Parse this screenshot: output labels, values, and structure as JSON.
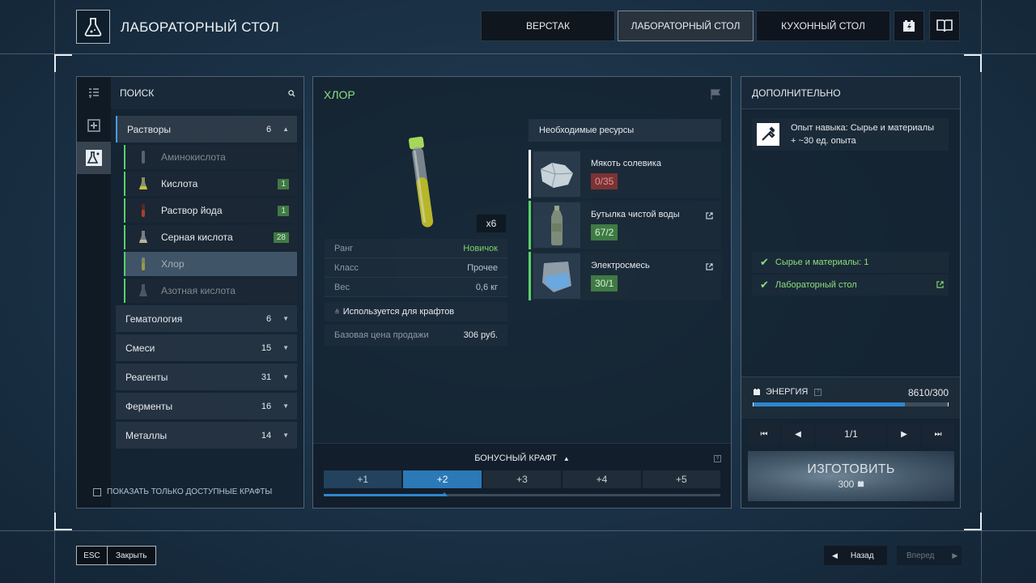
{
  "header": {
    "title": "ЛАБОРАТОРНЫЙ СТОЛ",
    "icon": "flask-icon",
    "tabs": [
      {
        "label": "ВЕРСТАК",
        "active": false
      },
      {
        "label": "ЛАБОРАТОРНЫЙ СТОЛ",
        "active": true
      },
      {
        "label": "КУХОННЫЙ СТОЛ",
        "active": false
      }
    ]
  },
  "sidebar": {
    "search_placeholder": "ПОИСК",
    "categories": [
      {
        "name": "Растворы",
        "count": "6",
        "open": true,
        "items": [
          {
            "name": "Аминокислота",
            "badge": "",
            "state": "disabled"
          },
          {
            "name": "Кислота",
            "badge": "1",
            "state": "normal"
          },
          {
            "name": "Раствор йода",
            "badge": "1",
            "state": "normal"
          },
          {
            "name": "Серная кислота",
            "badge": "28",
            "state": "normal"
          },
          {
            "name": "Хлор",
            "badge": "",
            "state": "selected"
          },
          {
            "name": "Азотная кислота",
            "badge": "",
            "state": "disabled"
          }
        ]
      },
      {
        "name": "Гематология",
        "count": "6",
        "open": false
      },
      {
        "name": "Смеси",
        "count": "15",
        "open": false
      },
      {
        "name": "Реагенты",
        "count": "31",
        "open": false
      },
      {
        "name": "Ферменты",
        "count": "16",
        "open": false
      },
      {
        "name": "Металлы",
        "count": "14",
        "open": false
      }
    ],
    "available_only_label": "ПОКАЗАТЬ ТОЛЬКО ДОСТУПНЫЕ КРАФТЫ"
  },
  "item": {
    "title": "ХЛОР",
    "quantity": "x6",
    "props": [
      {
        "key": "Ранг",
        "value": "Новичок",
        "green": true
      },
      {
        "key": "Класс",
        "value": "Прочее",
        "green": false
      },
      {
        "key": "Вес",
        "value": "0,6 кг",
        "green": false
      }
    ],
    "used_for": "Используется для крафтов",
    "sale_label": "Базовая цена продажи",
    "sale_value": "306 руб."
  },
  "resources": {
    "heading": "Необходимые ресурсы",
    "list": [
      {
        "name": "Мякоть солевика",
        "count": "0/35",
        "status": "bad",
        "link": false,
        "icon": "salt-crystal-icon"
      },
      {
        "name": "Бутылка чистой воды",
        "count": "67/2",
        "status": "ok",
        "link": true,
        "icon": "water-bottle-icon"
      },
      {
        "name": "Электросмесь",
        "count": "30/1",
        "status": "ok",
        "link": true,
        "icon": "powder-bag-icon"
      }
    ]
  },
  "bonus": {
    "title": "БОНУСНЫЙ КРАФТ",
    "steps": [
      "+1",
      "+2",
      "+3",
      "+4",
      "+5"
    ],
    "active_step": 1,
    "progress": 0.3
  },
  "extra": {
    "title": "ДОПОЛНИТЕЛЬНО",
    "skill_line1": "Опыт навыка: Сырье и материалы",
    "skill_line2": "+ ~30 ед. опыта",
    "requirements": [
      {
        "text": "Сырье и материалы: 1",
        "link": false
      },
      {
        "text": "Лабораторный стол",
        "link": true
      }
    ],
    "energy_label": "ЭНЕРГИЯ",
    "energy_value": "8610/300",
    "energy_fraction": 0.78,
    "page": "1/1",
    "craft_label": "ИЗГОТОВИТЬ",
    "craft_cost": "300"
  },
  "footer": {
    "esc_key": "ESC",
    "close_label": "Закрыть",
    "back_label": "Назад",
    "forward_label": "Вперед"
  },
  "colors": {
    "accent_blue": "#2f86cf",
    "ok_green": "#8be07a",
    "bad_red": "#7a3336"
  }
}
